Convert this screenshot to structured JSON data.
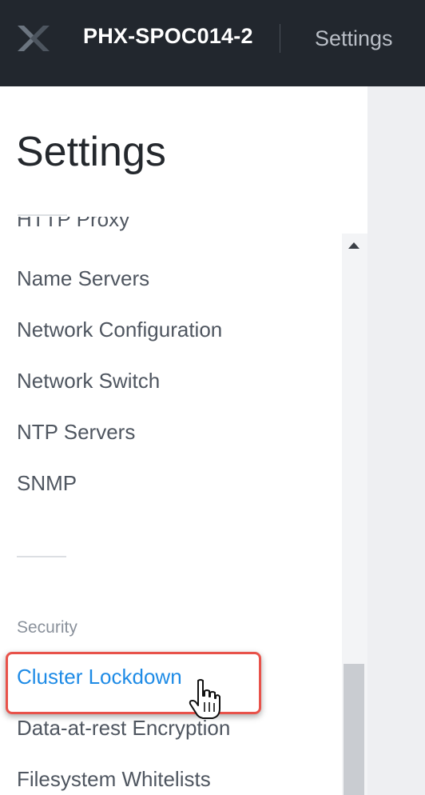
{
  "topbar": {
    "logo_icon": "nutanix-x-logo-icon",
    "cluster_name": "PHX-SPOC014-2",
    "section_label": "Settings"
  },
  "panel": {
    "title": "Settings",
    "partial_item": "HTTP Proxy",
    "items": [
      {
        "label": "Name Servers"
      },
      {
        "label": "Network Configuration"
      },
      {
        "label": "Network Switch"
      },
      {
        "label": "NTP Servers"
      },
      {
        "label": "SNMP"
      }
    ],
    "security_section": {
      "label": "Security",
      "items": [
        {
          "label": "Cluster Lockdown",
          "active": true
        },
        {
          "label": "Data-at-rest Encryption"
        },
        {
          "label": "Filesystem Whitelists"
        }
      ]
    }
  },
  "colors": {
    "topbar_bg": "#22272e",
    "active_link": "#1e8be6",
    "highlight_border": "#e8524a"
  },
  "icons": {
    "scroll_up": "scroll-up-arrow-icon",
    "cursor": "hand-pointer-cursor-icon"
  }
}
